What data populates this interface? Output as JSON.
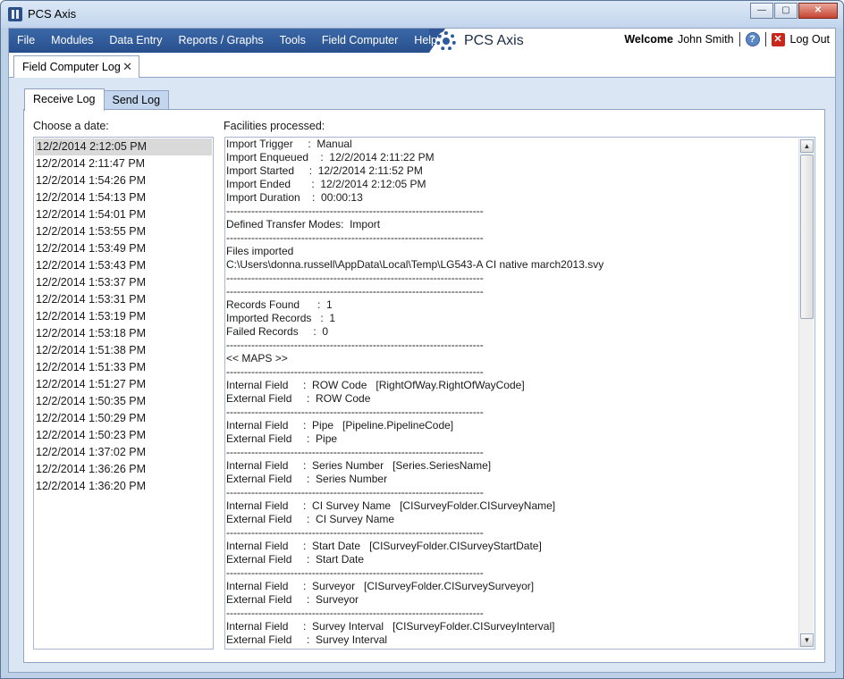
{
  "window": {
    "title": "PCS Axis",
    "buttons": [
      "—",
      "▢",
      "✕"
    ]
  },
  "menu": {
    "items": [
      "File",
      "Modules",
      "Data Entry",
      "Reports / Graphs",
      "Tools",
      "Field Computer",
      "Help"
    ],
    "brand": "PCS Axis",
    "welcome_label": "Welcome",
    "user_name": "John Smith",
    "logout_label": "Log Out"
  },
  "doc_tab": {
    "label": "Field Computer Log",
    "close": "✕"
  },
  "sub_tabs": [
    "Receive Log",
    "Send Log"
  ],
  "left": {
    "heading": "Choose a date:",
    "dates": [
      "12/2/2014 2:12:05 PM",
      "12/2/2014 2:11:47 PM",
      "12/2/2014 1:54:26 PM",
      "12/2/2014 1:54:13 PM",
      "12/2/2014 1:54:01 PM",
      "12/2/2014 1:53:55 PM",
      "12/2/2014 1:53:49 PM",
      "12/2/2014 1:53:43 PM",
      "12/2/2014 1:53:37 PM",
      "12/2/2014 1:53:31 PM",
      "12/2/2014 1:53:19 PM",
      "12/2/2014 1:53:18 PM",
      "12/2/2014 1:51:38 PM",
      "12/2/2014 1:51:33 PM",
      "12/2/2014 1:51:27 PM",
      "12/2/2014 1:50:35 PM",
      "12/2/2014 1:50:29 PM",
      "12/2/2014 1:50:23 PM",
      "12/2/2014 1:37:02 PM",
      "12/2/2014 1:36:26 PM",
      "12/2/2014 1:36:20 PM"
    ],
    "selected_index": 0
  },
  "right": {
    "heading": "Facilities processed:",
    "lines": [
      "Import Trigger     :  Manual",
      "Import Enqueued    :  12/2/2014 2:11:22 PM",
      "Import Started     :  12/2/2014 2:11:52 PM",
      "Import Ended       :  12/2/2014 2:12:05 PM",
      "Import Duration    :  00:00:13",
      "------------------------------------------------------------------------",
      "Defined Transfer Modes:  Import",
      "------------------------------------------------------------------------",
      "Files imported",
      "C:\\Users\\donna.russell\\AppData\\Local\\Temp\\LG543-A CI native march2013.svy",
      "------------------------------------------------------------------------",
      "------------------------------------------------------------------------",
      "Records Found      :  1",
      "Imported Records   :  1",
      "Failed Records     :  0",
      "------------------------------------------------------------------------",
      "<< MAPS >>",
      "------------------------------------------------------------------------",
      "Internal Field     :  ROW Code   [RightOfWay.RightOfWayCode]",
      "External Field     :  ROW Code",
      "------------------------------------------------------------------------",
      "Internal Field     :  Pipe   [Pipeline.PipelineCode]",
      "External Field     :  Pipe",
      "------------------------------------------------------------------------",
      "Internal Field     :  Series Number   [Series.SeriesName]",
      "External Field     :  Series Number",
      "------------------------------------------------------------------------",
      "Internal Field     :  CI Survey Name   [CISurveyFolder.CISurveyName]",
      "External Field     :  CI Survey Name",
      "------------------------------------------------------------------------",
      "Internal Field     :  Start Date   [CISurveyFolder.CISurveyStartDate]",
      "External Field     :  Start Date",
      "------------------------------------------------------------------------",
      "Internal Field     :  Surveyor   [CISurveyFolder.CISurveySurveyor]",
      "External Field     :  Surveyor",
      "------------------------------------------------------------------------",
      "Internal Field     :  Survey Interval   [CISurveyFolder.CISurveyInterval]",
      "External Field     :  Survey Interval"
    ]
  },
  "scroll": {
    "up": "▲",
    "down": "▼"
  }
}
